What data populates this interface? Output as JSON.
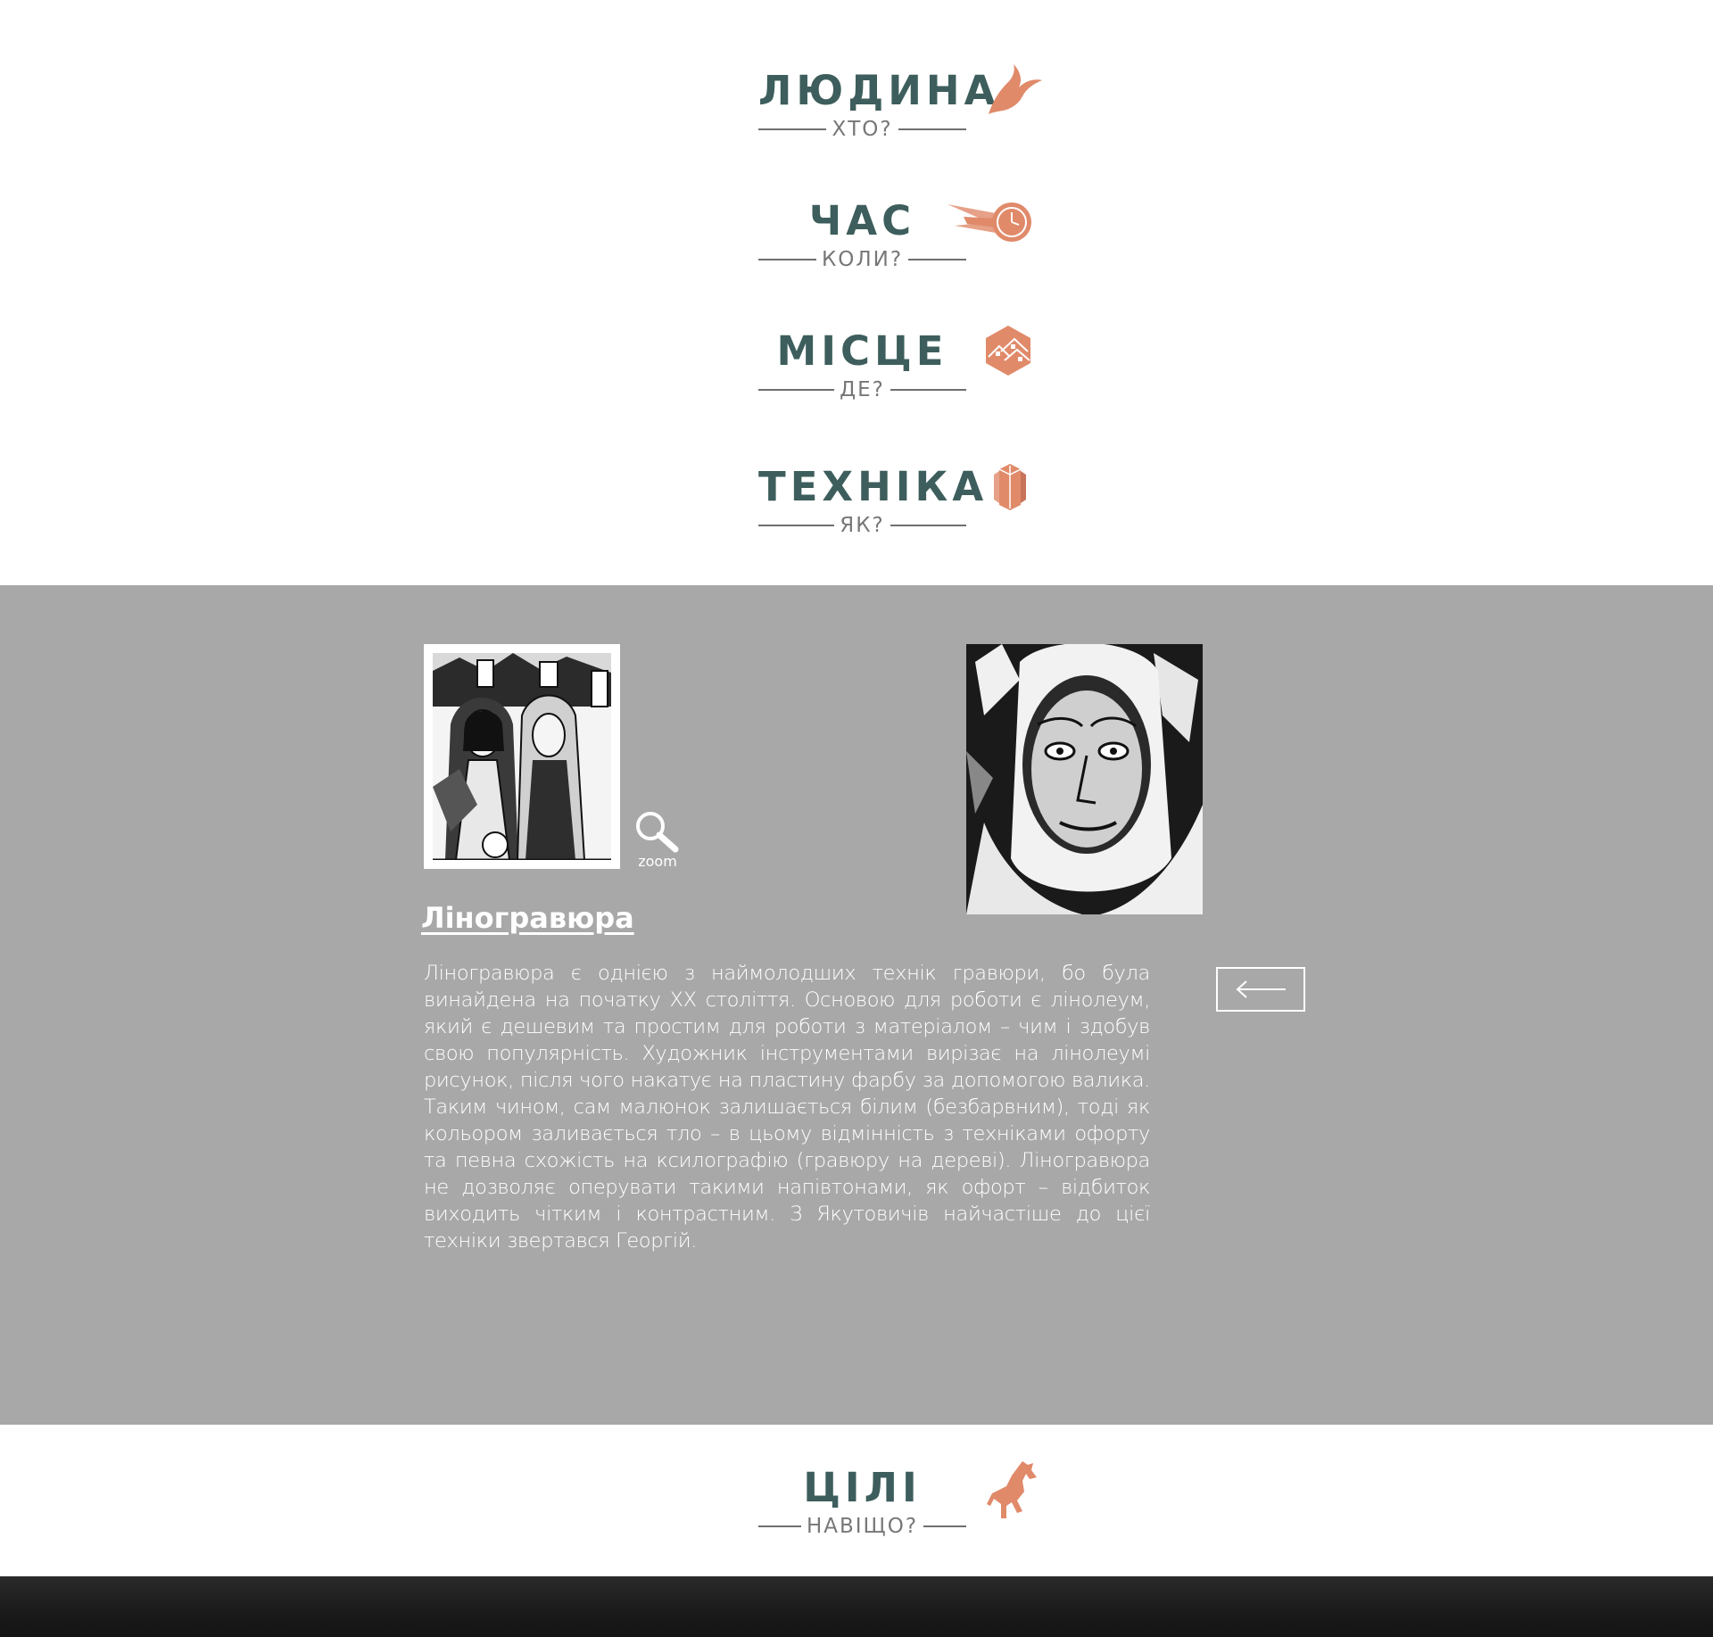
{
  "nav": [
    {
      "title": "ЛЮДИНА",
      "subtitle": "ХТО?",
      "icon": "swallow-icon"
    },
    {
      "title": "ЧАС",
      "subtitle": "КОЛИ?",
      "icon": "clock-icon"
    },
    {
      "title": "МІСЦЕ",
      "subtitle": "ДЕ?",
      "icon": "houses-hexagon-icon"
    },
    {
      "title": "ТЕХНІКА",
      "subtitle": "ЯК?",
      "icon": "crystal-icon"
    }
  ],
  "article": {
    "zoom_label": "zoom",
    "heading": "Ліногравюра",
    "body": "Ліногравюра є однією з наймолодших технік гравюри, бо була винайдена на початку XX століття. Основою для роботи є лінолеум, який є дешевим та простим для роботи з матеріалом – чим і здобув свою популярність. Художник інструментами вирізає на лінолеумі рисунок, після чого накатує на пластину фарбу за допомогою валика. Таким чином, сам малюнок залишається білим (безбарвним), тоді як кольором заливається тло – в цьому відмінність з техніками офорту та певна схожість на ксилографію (гравюру на дереві). Ліногравюра не дозволяє оперувати такими напівтонами, як офорт – відбиток виходить чітким і контрастним. З Якутовичів найчастіше до цієї техніки звертався Георгій."
  },
  "goals": {
    "title": "ЦІЛІ",
    "subtitle": "НАВІЩО?",
    "icon": "horse-icon"
  },
  "colors": {
    "accent": "#e08a6a",
    "heading": "#3d5e5c",
    "gray_band": "#a8a8a8",
    "subtitle": "#777777"
  }
}
